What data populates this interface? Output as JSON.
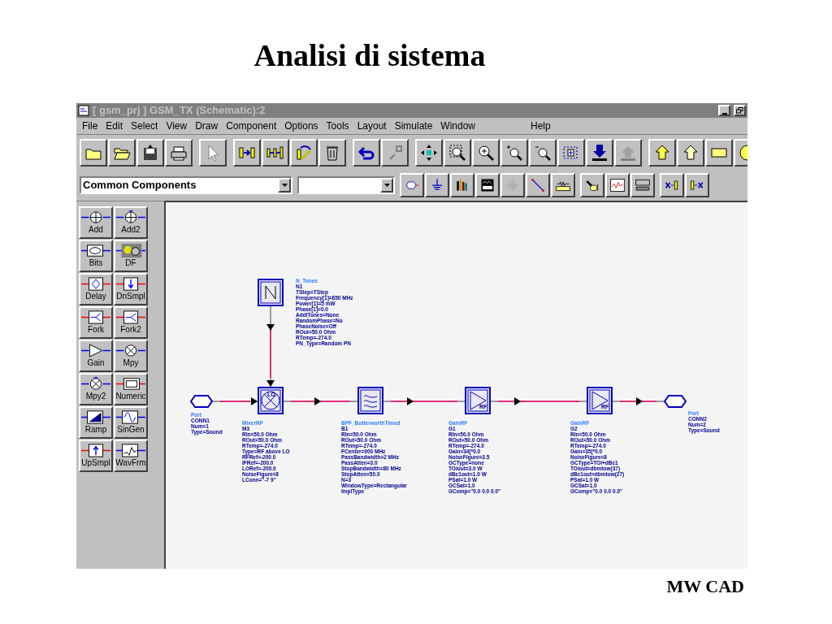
{
  "slide": {
    "title": "Analisi di sistema",
    "footer": "MW CAD"
  },
  "window": {
    "title": "[ gsm_prj ] GSM_TX (Schematic):2"
  },
  "menu": [
    "File",
    "Edit",
    "Select",
    "View",
    "Draw",
    "Component",
    "Options",
    "Tools",
    "Layout",
    "Simulate",
    "Window",
    "Help"
  ],
  "library_dropdown": {
    "value": "Common Components"
  },
  "palette": [
    {
      "label": "Add"
    },
    {
      "label": "Add2"
    },
    {
      "label": "Bits"
    },
    {
      "label": "DF"
    },
    {
      "label": "Delay"
    },
    {
      "label": "DnSmpl"
    },
    {
      "label": "Fork"
    },
    {
      "label": "Fork2"
    },
    {
      "label": "Gain"
    },
    {
      "label": "Mpy"
    },
    {
      "label": "Mpy2"
    },
    {
      "label": "Numeric"
    },
    {
      "label": "Ramp"
    },
    {
      "label": "SinGen"
    },
    {
      "label": "UpSmpl"
    },
    {
      "label": "WavFrm"
    }
  ],
  "schematic": {
    "components": [
      {
        "kind": "source",
        "lines": [
          "N_Tones",
          "N1",
          "TStep=TStep",
          "Frequency[1]=850 MHz",
          "Power[1]=5 mW",
          "Phase[1]=0.0",
          "AddlTones=None",
          "RandomPhase=No",
          "PhaseNoise=Off",
          "ROut=50.0 Ohm",
          "RTemp=-274.0",
          "PN_Type=Random PN"
        ]
      },
      {
        "kind": "port",
        "lines": [
          "Port",
          "CONN1",
          "Num=1",
          "Type=Sound"
        ]
      },
      {
        "kind": "mixer",
        "symbol_text": "LO",
        "lines": [
          "MixerRF",
          "M3",
          "RIn=50.0 Ohm",
          "ROut=50.0 Ohm",
          "RTemp=-274.0",
          "Type=RF above LO",
          "RFRef=-200.0",
          "IFRef=-200.0",
          "LORef=-200.0",
          "NoiseFigure=8",
          "LConn=\"-7 9\""
        ]
      },
      {
        "kind": "filter",
        "lines": [
          "BPF_ButterworthTimed",
          "B1",
          "RIn=50.0 Ohm",
          "ROut=50.0 Ohm",
          "RTemp=-274.0",
          "FCenter=900 MHz",
          "PassBandwidth=2 MHz",
          "PassAtten=3.0",
          "StopBandwidth=80 MHz",
          "StopAtten=50.0",
          "N=3",
          "WindowType=Rectangular",
          "ImplType"
        ]
      },
      {
        "kind": "amplifier",
        "symbol_text": "RF",
        "lines": [
          "GainRF",
          "G1",
          "RIn=50.0 Ohm",
          "ROut=50.0 Ohm",
          "RTemp=-274.0",
          "Gain=34[*0.0",
          "NoiseFigure=3.5",
          "GCType=none",
          "TOIout=3.0 W",
          "dBc1out=1.0 W",
          "PSat=1.0 W",
          "GCSat=1.0",
          "GComp=\"0.0 0.0 0.0\""
        ]
      },
      {
        "kind": "amplifier",
        "symbol_text": "RF",
        "lines": [
          "GainRF",
          "G2",
          "RIn=50.0 Ohm",
          "ROut=50.0 Ohm",
          "RTemp=-274.0",
          "Gain=35[*0.0",
          "NoiseFigure=8",
          "GCType=TOI+dBc1",
          "TOIout=dbmtow(37)",
          "dBc1out=dbmtow(27)",
          "PSat=1.0 W",
          "GCSat=1.0",
          "GComp=\"0.0 0.0 0.0\""
        ]
      },
      {
        "kind": "port",
        "lines": [
          "Port",
          "CONN2",
          "Num=2",
          "Type=Sound"
        ]
      }
    ]
  }
}
